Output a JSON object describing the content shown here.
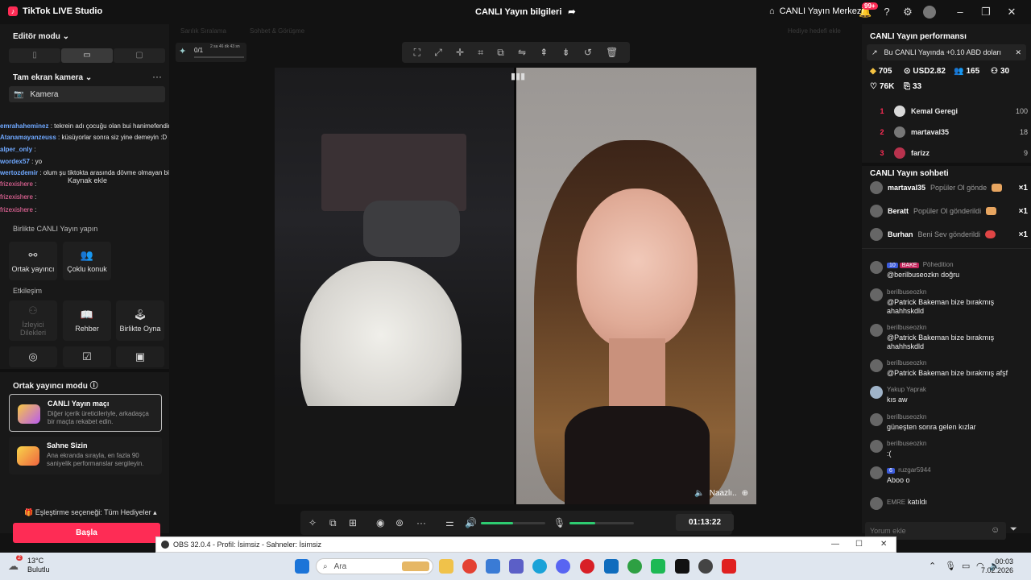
{
  "window": {
    "app_title": "TikTok LIVE Studio",
    "live_info": "CANLI Yayın bilgileri",
    "live_center": "CANLI Yayın Merkezi",
    "notif_badge": "99+"
  },
  "left_panel": {
    "editor_mode": "Editör modu",
    "source_title": "Tam ekran kamera",
    "camera_label": "Kamera",
    "add_source": "Kaynak ekle",
    "overlay_chat": [
      {
        "user": "emrahaheminez",
        "text": ": tekrein adı çocuğu olan bui hanimefendinin çocuğu byuması"
      },
      {
        "user": "Atanamayanzeuss",
        "text": ": küsüyorlar sonra siz yine demeyin :D"
      },
      {
        "user": "alper_only",
        "text": ":"
      },
      {
        "user": "wordex57",
        "text": ": yo"
      },
      {
        "user": "wertozdemir",
        "text": ": olum şu tiktokta arasında dövme olmayan bi tane karı varmı"
      },
      {
        "user": "frizexishere",
        "text": ":"
      },
      {
        "user": "frizexishere",
        "text": ":"
      },
      {
        "user": "frizexishere",
        "text": ":"
      }
    ],
    "together_title": "Birlikte CANLI Yayın yapın",
    "together_tiles": [
      "Ortak yayıncı",
      "Çoklu konuk"
    ],
    "interaction_title": "Etkileşim",
    "interaction_tiles": [
      "İzleyici Dilekleri",
      "Rehber",
      "Birlikte Oyna"
    ],
    "cohost_title": "Ortak yayıncı modu",
    "cards": [
      {
        "title": "CANLI Yayın maçı",
        "desc": "Diğer içerik üreticileriyle, arkadaşça bir maçta rekabet edin."
      },
      {
        "title": "Sahne Sizin",
        "desc": "Ana ekranda sırayla, en fazla 90 saniyelik performanslar sergileyin."
      }
    ],
    "match_option": "Eşleştirme seçeneği: Tüm Hediyeler",
    "start_label": "Başla"
  },
  "center": {
    "faded_labels": [
      "Sarılık Sıralama",
      "Sohbet & Görüşme",
      "Hediye hedefi ekle"
    ],
    "progress_text": "0/1",
    "progress_time": "2 sa 46 dk 43 sn",
    "progress_fraction": 0.0,
    "guest_name": "Naazlı..",
    "timer": "01:13:22",
    "volume_level": 0.5,
    "mic_level": 0.4
  },
  "right_panel": {
    "perf_title": "CANLI Yayın performansı",
    "perf_banner": "Bu CANLI Yayında +0.10 ABD doları",
    "stats": {
      "diamonds": "705",
      "usd": "USD2.82",
      "viewers": "165",
      "new_followers": "30",
      "likes": "76K",
      "shares": "33"
    },
    "ranking": [
      {
        "rank": "1",
        "name": "Kemal Geregi",
        "score": "100"
      },
      {
        "rank": "2",
        "name": "martaval35",
        "score": "18"
      },
      {
        "rank": "3",
        "name": "farizz",
        "score": "9"
      }
    ],
    "chat_title": "CANLI Yayın sohbeti",
    "gifts": [
      {
        "user": "martaval35",
        "action": "Popüler Ol gönde",
        "count": "×1"
      },
      {
        "user": "Beratt",
        "action": "Popüler Ol gönderildi",
        "count": "×1"
      },
      {
        "user": "Burhan",
        "action": "Beni Sev gönderildi",
        "count": "×1"
      }
    ],
    "chat": [
      {
        "name": "Pöhedition",
        "badge1": "10",
        "badge2": "BAKE",
        "msg": "@berilbuseozkn doğru"
      },
      {
        "name": "berilbuseozkn",
        "msg": "@Patrick Bakeman bize bırakmış ahahhskdld"
      },
      {
        "name": "berilbuseozkn",
        "msg": "@Patrick Bakeman bize bırakmış ahahhskdld"
      },
      {
        "name": "berilbuseozkn",
        "msg": "@Patrick Bakeman bize bırakmış afşf"
      },
      {
        "name": "Yakup Yaprak",
        "msg": "kıs aw"
      },
      {
        "name": "berilbuseozkn",
        "msg": "güneşten sonra gelen kızlar"
      },
      {
        "name": "berilbuseozkn",
        "msg": ":("
      },
      {
        "name": "ruzgar5944",
        "badge1": "6",
        "msg": "Aboo o"
      },
      {
        "name": "EMRE",
        "msg": "katıldı"
      }
    ],
    "comment_placeholder": "Yorum ekle"
  },
  "obs": {
    "title": "OBS 32.0.4 - Profil: İsimsiz - Sahneler: İsimsiz"
  },
  "taskbar": {
    "temp": "13°C",
    "weather": "Bulutlu",
    "weather_badge": "2",
    "search_placeholder": "Ara",
    "time": "00:03",
    "date": "7.02.2026"
  }
}
